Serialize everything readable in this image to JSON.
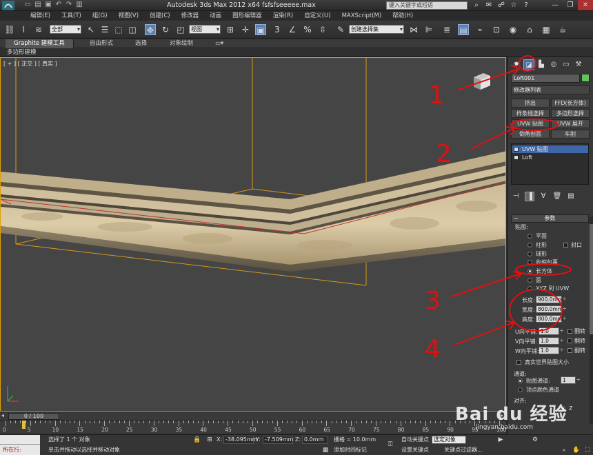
{
  "window": {
    "title": "Autodesk 3ds Max  2012 x64      fsfsfseeeee.max",
    "search_placeholder": "键入关键字或短语",
    "controls": [
      "—",
      "❐",
      "✕"
    ]
  },
  "menu": [
    "编辑(E)",
    "工具(T)",
    "组(G)",
    "视图(V)",
    "创建(C)",
    "修改器",
    "动画",
    "图形编辑器",
    "渲染(R)",
    "自定义(U)",
    "MAXScript(M)",
    "帮助(H)"
  ],
  "toolbar": {
    "selection_filter": "全部",
    "ref_coord": "视图",
    "named_selection": "创建选择集"
  },
  "ribbon": {
    "tabs": [
      "Graphite 建模工具",
      "自由形式",
      "选择",
      "对象绘制"
    ],
    "subtitle": "多边形建模"
  },
  "viewport": {
    "label": "[ + ] [ 正交 ] [ 真实 ]"
  },
  "panel": {
    "object_name": "Loft001",
    "modifier_list": "修改器列表",
    "buttons": [
      "挤出",
      "FFD(长方体)",
      "样条线选择",
      "多边形选择",
      "UVW 贴图",
      "UVW 展开",
      "倒角剖面",
      "车削"
    ],
    "stack": [
      "UVW 贴图",
      "Loft"
    ],
    "rollout": "参数",
    "mapping_label": "贴图:",
    "mapping_options": [
      "平面",
      "柱形",
      "球形",
      "收缩包裹",
      "长方体",
      "面",
      "XYZ 到 UVW"
    ],
    "cap_label": "封口",
    "length_label": "长度:",
    "length": "900.0mm",
    "width_label": "宽度:",
    "width": "800.0mm",
    "height_label": "高度:",
    "height": "800.0mm",
    "u_tile_label": "U向平铺:",
    "u_tile": "1.0",
    "v_tile_label": "V向平铺:",
    "v_tile": "1.0",
    "w_tile_label": "W向平铺:",
    "w_tile": "1.0",
    "flip_label": "翻转",
    "real_world": "真实世界贴图大小",
    "channel_label": "通道:",
    "map_channel_label": "贴图通道:",
    "map_channel": "1",
    "vertex_color": "顶点颜色通道",
    "align_label": "对齐:",
    "align_z": "Z"
  },
  "timeline": {
    "frame": "0 / 100",
    "ticks": [
      "0",
      "5",
      "10",
      "15",
      "20",
      "25",
      "30",
      "35",
      "40",
      "45",
      "50",
      "55",
      "60",
      "65",
      "70",
      "75",
      "80",
      "85",
      "90",
      "95",
      "100"
    ]
  },
  "status": {
    "in_scene": "所在行:",
    "selected": "选择了 1 个 对象",
    "prompt": "单击并拖动以选择并移动对象",
    "x_label": "X:",
    "x": "-38.095mm",
    "y_label": "Y:",
    "y": "-7.509mm",
    "z_label": "Z:",
    "z": "0.0mm",
    "grid": "栅格 = 10.0mm",
    "auto_key": "自动关键点",
    "selected_obj": "选定对象",
    "set_key": "设置关键点",
    "key_filters": "关键点过滤器...",
    "add_time_tag": "添加时间标记"
  },
  "annotations": [
    "1",
    "2",
    "3",
    "4"
  ],
  "watermark": {
    "brand": "Bai du 经验",
    "url": "jingyan.baidu.com"
  }
}
